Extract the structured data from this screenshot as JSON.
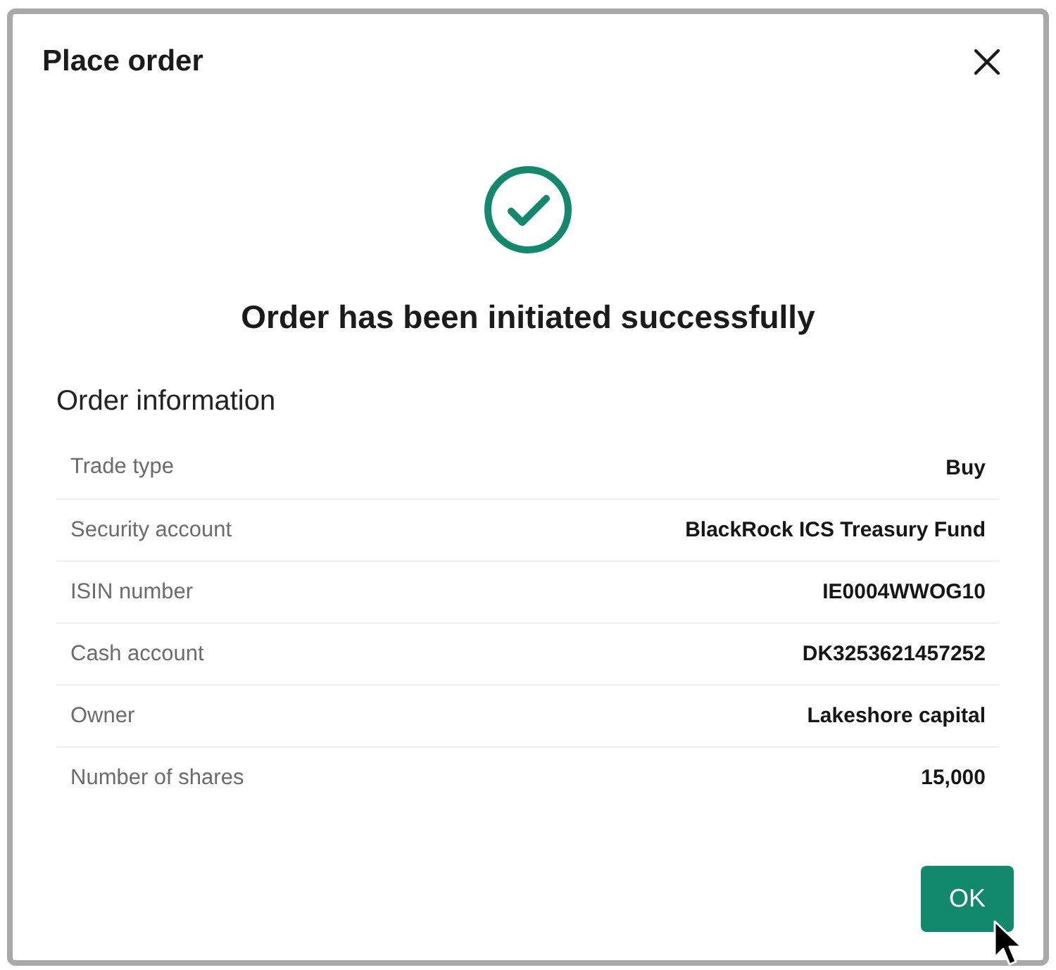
{
  "dialog": {
    "title": "Place order"
  },
  "status": {
    "kind": "success",
    "message": "Order has been initiated successfully"
  },
  "section": {
    "title": "Order information",
    "rows": [
      {
        "label": "Trade type",
        "value": "Buy"
      },
      {
        "label": "Security account",
        "value": "BlackRock ICS Treasury Fund"
      },
      {
        "label": "ISIN number",
        "value": "IE0004WWOG10"
      },
      {
        "label": "Cash account",
        "value": "DK3253621457252"
      },
      {
        "label": "Owner",
        "value": "Lakeshore capital"
      },
      {
        "label": "Number of shares",
        "value": "15,000"
      }
    ]
  },
  "buttons": [
    {
      "label": "OK",
      "kind": "primary"
    }
  ]
}
